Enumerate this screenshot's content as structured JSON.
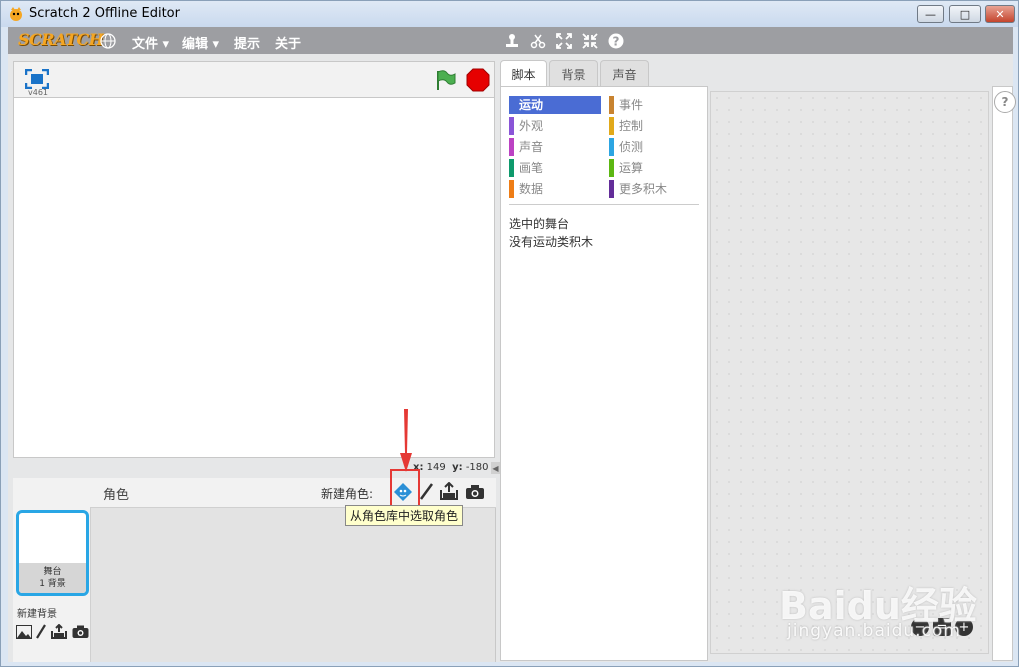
{
  "window": {
    "title": "Scratch 2 Offline Editor",
    "min": "—",
    "max": "□",
    "close": "✕"
  },
  "menu": {
    "logo": "SCRATCH",
    "file": "文件",
    "edit": "编辑",
    "tips": "提示",
    "about": "关于"
  },
  "stage": {
    "version": "v461",
    "x_label": "x:",
    "x_value": "149",
    "y_label": "y:",
    "y_value": "-180"
  },
  "sprites": {
    "header": "角色",
    "new_sprite_label": "新建角色:",
    "tooltip": "从角色库中选取角色",
    "stage_name": "舞台",
    "backdrop_count": "1 背景",
    "new_backdrop": "新建背景"
  },
  "tabs": {
    "scripts": "脚本",
    "backdrops": "背景",
    "sounds": "声音"
  },
  "categories": [
    {
      "label": "运动",
      "color": "#4a6cd4"
    },
    {
      "label": "事件",
      "color": "#c88330"
    },
    {
      "label": "外观",
      "color": "#8a55d7"
    },
    {
      "label": "控制",
      "color": "#e1a91a"
    },
    {
      "label": "声音",
      "color": "#bb42c3"
    },
    {
      "label": "侦测",
      "color": "#2ca5e2"
    },
    {
      "label": "画笔",
      "color": "#0e9a6c"
    },
    {
      "label": "运算",
      "color": "#5cb712"
    },
    {
      "label": "数据",
      "color": "#ee7d16"
    },
    {
      "label": "更多积木",
      "color": "#632d99"
    }
  ],
  "palette": {
    "selected_line": "选中的舞台",
    "no_blocks_line": "没有运动类积木"
  },
  "zoom": {
    "out": "−",
    "reset": "=",
    "in": "+"
  },
  "watermark": {
    "brand": "Baidu经验",
    "url": "jingyan.baidu.com"
  }
}
